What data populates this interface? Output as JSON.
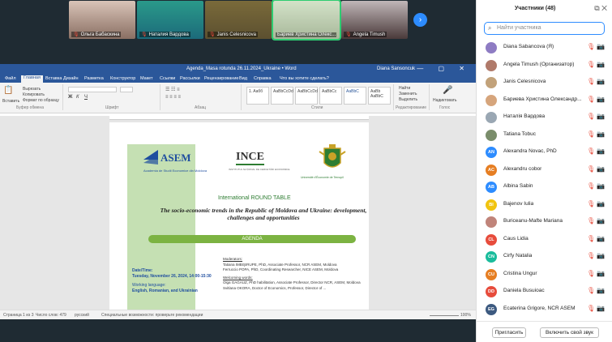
{
  "video_strip": {
    "tiles": [
      {
        "name": "Ольга Бабаскина"
      },
      {
        "name": "Наталия Вардова"
      },
      {
        "name": "Janis Celesnicova"
      },
      {
        "name": "Бариев Христина Олекс..."
      },
      {
        "name": "Angela Timush"
      }
    ],
    "next_icon": "chevron-right-icon"
  },
  "word": {
    "title": "Agenda_Masa rotunda 26.11.2024_Ukraine • Word",
    "user": "Diana Sansoncuk",
    "tabs": [
      "Файл",
      "Главная",
      "Вставка",
      "Дизайн",
      "Разметка",
      "Конструктор",
      "Макет",
      "Ссылки",
      "Рассылки",
      "Рецензирование",
      "Вид",
      "Справка",
      "Что вы хотите сделать?"
    ],
    "ribbon": {
      "clipboard": "Вставить",
      "cut": "Вырезать",
      "copy": "Копировать",
      "format_painter": "Формат по образцу",
      "clipboard_group": "Буфер обмена",
      "font_group": "Шрифт",
      "paragraph_group": "Абзац",
      "styles_group": "Стили",
      "editing_group": "Редактирование",
      "styles": [
        "1. Aaбб",
        "AaBbCcDd",
        "AaBbCcDd",
        "AaBbCc",
        "AaBbC",
        "AaBb AaBbC"
      ],
      "find": "Найти",
      "replace": "Заменить",
      "select": "Выделить",
      "dictate": "Надиктовать",
      "voice_group": "Голос"
    },
    "document": {
      "asem_word": "ASEM",
      "asem_sub": "Academia de Studii Economice din Moldova",
      "ince_word": "INCE",
      "ince_sub": "INSTITUTUL NAȚIONAL DE CERCETĂRI ECONOMICE",
      "crest_sub": "Université d'Économie de Ternopil",
      "round_table": "International ROUND TABLE",
      "topic": "The socio-economic trends in the Republic of Moldova and Ukraine: development, challenges and opportunities",
      "agenda": "AGENDA",
      "date_label": "Date/Time:",
      "date_value": "Tuesday, November 26, 2024, 14:00-15:30",
      "lang_label": "Working language:",
      "lang_value": "English, Romanian, and Ukrainian",
      "moderators_label": "Moderators:",
      "mod1": "Tatiana IMBIŞIRUPE, PhD, Associate Professor, NCR ASEM, Moldova",
      "mod2": "Ferruccio POPA, PhD, Coordinating Researcher, NICE ASEM, Moldova",
      "welcome_label": "Welcoming words:",
      "speaker1": "Olga GAGAUZ, PhD habilitation, Associate Professor, Director NCR, ASEM, Moldova",
      "speaker2": "Svitlana OKORA, Doctor of Economics, Professor, Director of ..."
    },
    "status": {
      "page": "Страница 1 из 3",
      "words": "Число слов: 479",
      "language": "русский",
      "accessibility": "Специальные возможности: проверьте рекомендации",
      "zoom": "100%"
    }
  },
  "sidebar": {
    "title": "Участники (48)",
    "search_placeholder": "Найти участника",
    "participants": [
      {
        "name": "Diana Sabancova (Я)",
        "initials": "",
        "color": "#8e7cc3"
      },
      {
        "name": "Angela Timush (Организатор)",
        "initials": "",
        "color": "#b07a6a"
      },
      {
        "name": "Janis Celesnicova",
        "initials": "",
        "color": "#c2a27a"
      },
      {
        "name": "Бариева Христина Олександр...",
        "initials": "",
        "color": "#d6a57c"
      },
      {
        "name": "Наталія Вардова",
        "initials": "",
        "color": "#9aa7b3"
      },
      {
        "name": "Tatiana Tobuc",
        "initials": "",
        "color": "#7a8d6b"
      },
      {
        "name": "Alexandra Novac, PhD",
        "initials": "AN",
        "color": "#2d8cff"
      },
      {
        "name": "Alexandru cobor",
        "initials": "AC",
        "color": "#e67e22"
      },
      {
        "name": "Albina Sabin",
        "initials": "AB",
        "color": "#2d8cff"
      },
      {
        "name": "Bajenov Iulia",
        "initials": "BI",
        "color": "#f1c40f"
      },
      {
        "name": "Buriceanu-Mafte Mariana",
        "initials": "",
        "color": "#c0847a"
      },
      {
        "name": "Caus Lidia",
        "initials": "CL",
        "color": "#e74c3c"
      },
      {
        "name": "Cirfy Natalia",
        "initials": "CN",
        "color": "#1abc9c"
      },
      {
        "name": "Cristina Ungur",
        "initials": "CU",
        "color": "#e67e22"
      },
      {
        "name": "Daniela Busuioac",
        "initials": "DD",
        "color": "#e74c3c"
      },
      {
        "name": "Ecaterina Grigore, NCR ASEM",
        "initials": "EG",
        "color": "#3d5a80"
      }
    ],
    "invite_label": "Пригласить",
    "unmute_label": "Включить свой звук"
  }
}
